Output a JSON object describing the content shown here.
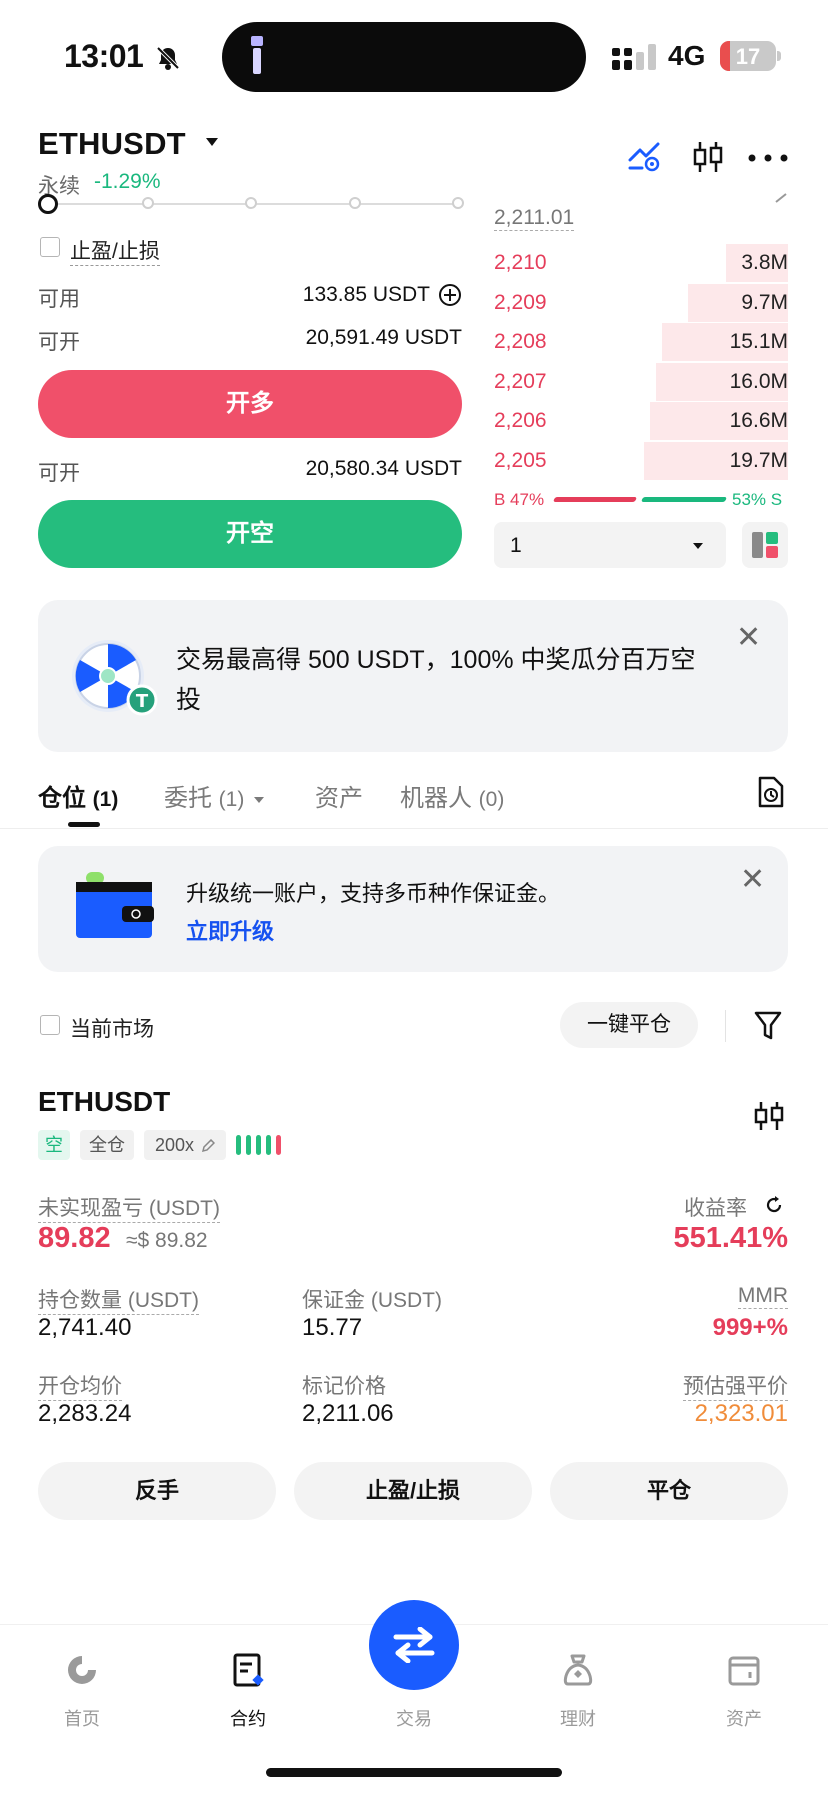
{
  "status_bar": {
    "time": "13:01",
    "network": "4G",
    "battery": "17",
    "battery_level": 0.17
  },
  "header": {
    "pair": "ETHUSDT",
    "contract_type": "永续",
    "change_pct": "-1.29%"
  },
  "order_form": {
    "tpsl_label": "止盈/止损",
    "available_label": "可用",
    "available_value": "133.85 USDT",
    "open_label_1": "可开",
    "open_value_1": "20,591.49 USDT",
    "long_button": "开多",
    "open_label_2": "可开",
    "open_value_2": "20,580.34 USDT",
    "short_button": "开空"
  },
  "orderbook": {
    "top_price": "2,211.01",
    "asks": [
      {
        "price": "2,210",
        "size": "3.8M",
        "depth": 0.21
      },
      {
        "price": "2,209",
        "size": "9.7M",
        "depth": 0.34
      },
      {
        "price": "2,208",
        "size": "15.1M",
        "depth": 0.43
      },
      {
        "price": "2,207",
        "size": "16.0M",
        "depth": 0.45
      },
      {
        "price": "2,206",
        "size": "16.6M",
        "depth": 0.47
      },
      {
        "price": "2,205",
        "size": "19.7M",
        "depth": 0.49
      }
    ],
    "buy_ratio": "B 47%",
    "sell_ratio": "53% S",
    "depth_precision": "1"
  },
  "promo": {
    "text": "交易最高得 500 USDT，100% 中奖瓜分百万空投"
  },
  "tabs": [
    {
      "label": "仓位",
      "count": "(1)"
    },
    {
      "label": "委托",
      "count": "(1)"
    },
    {
      "label": "资产",
      "count": ""
    },
    {
      "label": "机器人",
      "count": "(0)"
    }
  ],
  "upgrade": {
    "text": "升级统一账户，支持多币种作保证金。",
    "link": "立即升级"
  },
  "filters": {
    "current_market": "当前市场",
    "close_all": "一键平仓"
  },
  "position": {
    "symbol": "ETHUSDT",
    "side": "空",
    "margin_mode": "全仓",
    "leverage": "200x",
    "unrealized_pnl_label": "未实现盈亏 (USDT)",
    "unrealized_pnl": "89.82",
    "unrealized_pnl_usd": "≈$ 89.82",
    "roe_label": "收益率",
    "roe": "551.41%",
    "size_label": "持仓数量 (USDT)",
    "size": "2,741.40",
    "margin_label": "保证金 (USDT)",
    "margin": "15.77",
    "mmr_label": "MMR",
    "mmr": "999+%",
    "entry_label": "开仓均价",
    "entry": "2,283.24",
    "mark_label": "标记价格",
    "mark": "2,211.06",
    "liq_label": "预估强平价",
    "liq": "2,323.01",
    "btn_reverse": "反手",
    "btn_tpsl": "止盈/止损",
    "btn_close": "平仓"
  },
  "colors": {
    "green": "#1ab87e",
    "red": "#e53d5a",
    "orange": "#f08c3a",
    "brand_blue": "#1a5cff"
  },
  "bottom_nav": [
    {
      "label": "首页",
      "icon": "home-icon"
    },
    {
      "label": "合约",
      "icon": "contract-icon"
    },
    {
      "label": "交易",
      "icon": "swap-icon"
    },
    {
      "label": "理财",
      "icon": "finance-icon"
    },
    {
      "label": "资产",
      "icon": "wallet-icon"
    }
  ]
}
